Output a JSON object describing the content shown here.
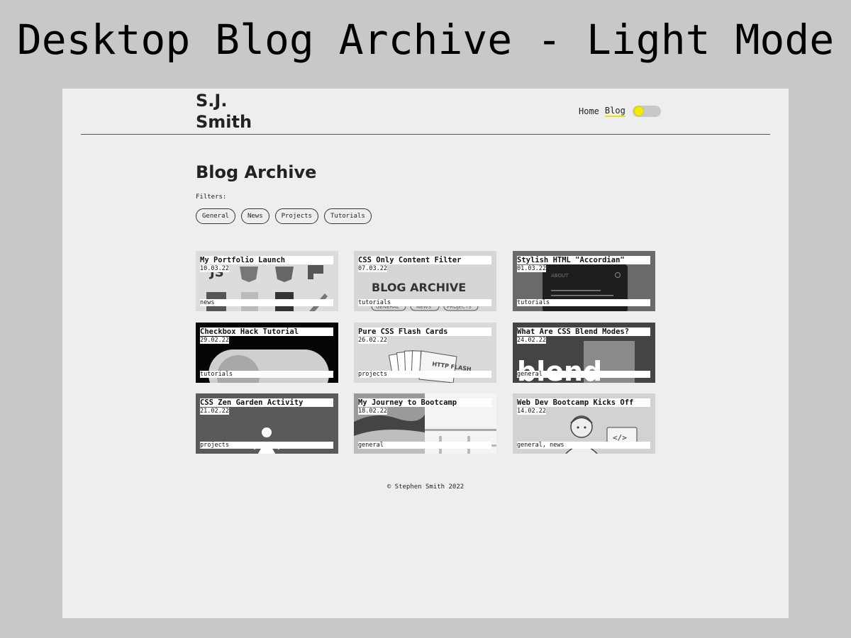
{
  "page_heading": "Desktop Blog Archive - Light Mode",
  "header": {
    "logo_line1": "S.J.",
    "logo_line2": "Smith",
    "nav": [
      {
        "label": "Home",
        "active": false
      },
      {
        "label": "Blog",
        "active": true
      }
    ],
    "theme_toggle": {
      "state": "light",
      "knob_color": "#f4ec00"
    }
  },
  "main": {
    "title": "Blog Archive",
    "filters_label": "Filters:",
    "filters": [
      "General",
      "News",
      "Projects",
      "Tutorials"
    ]
  },
  "posts": [
    {
      "title": "My Portfolio Launch",
      "date": "10.03.22",
      "tags": "news",
      "image": "tech-logos-grid"
    },
    {
      "title": "CSS Only Content Filter",
      "date": "07.03.22",
      "tags": "tutorials",
      "image": "blog-archive-screenshot",
      "image_text": "BLOG ARCHIVE",
      "image_chips": [
        "GENERAL",
        "NEWS",
        "PROJECTS"
      ]
    },
    {
      "title": "Stylish HTML \"Accordian\"",
      "date": "01.03.22",
      "tags": "tutorials",
      "image": "accordion-phone",
      "image_text": "ABOUT"
    },
    {
      "title": "Checkbox Hack Tutorial",
      "date": "29.02.22",
      "tags": "tutorials",
      "image": "toggle-switch"
    },
    {
      "title": "Pure CSS Flash Cards",
      "date": "26.02.22",
      "tags": "projects",
      "image": "flash-cards",
      "image_text": "HTTP FLASH"
    },
    {
      "title": "What Are CSS Blend Modes?",
      "date": "24.02.22",
      "tags": "general",
      "image": "blend-text",
      "image_text": "blend"
    },
    {
      "title": "CSS Zen Garden Activity",
      "date": "21.02.22",
      "tags": "projects",
      "image": "zen-figure"
    },
    {
      "title": "My Journey to Bootcamp",
      "date": "18.02.22",
      "tags": "general",
      "image": "landscape-split"
    },
    {
      "title": "Web Dev Bootcamp Kicks Off",
      "date": "14.02.22",
      "tags": "general, news",
      "image": "cartoon-coder",
      "image_text": "</>"
    }
  ],
  "footer": "© Stephen Smith 2022"
}
